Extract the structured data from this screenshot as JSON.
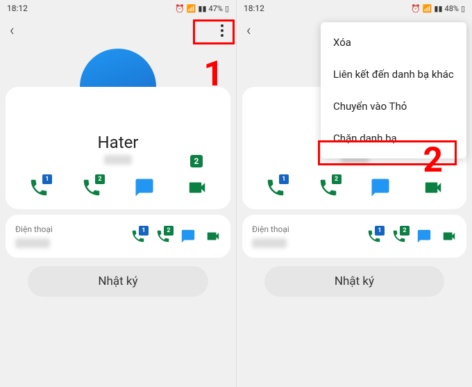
{
  "status": {
    "time": "18:12",
    "battery_l": "47%",
    "battery_r": "48%"
  },
  "contact": {
    "name": "Hater",
    "sim_badge": "2"
  },
  "sims": {
    "s1": "1",
    "s2": "2"
  },
  "list": {
    "phone_label": "Điện thoại"
  },
  "log_button": "Nhật ký",
  "annotations": {
    "one": "1",
    "two": "2"
  },
  "menu": {
    "delete": "Xóa",
    "link_other": "Liên kết đến danh bạ khác",
    "move_card": "Chuyển vào Thỏ",
    "block": "Chặn danh bạ"
  }
}
